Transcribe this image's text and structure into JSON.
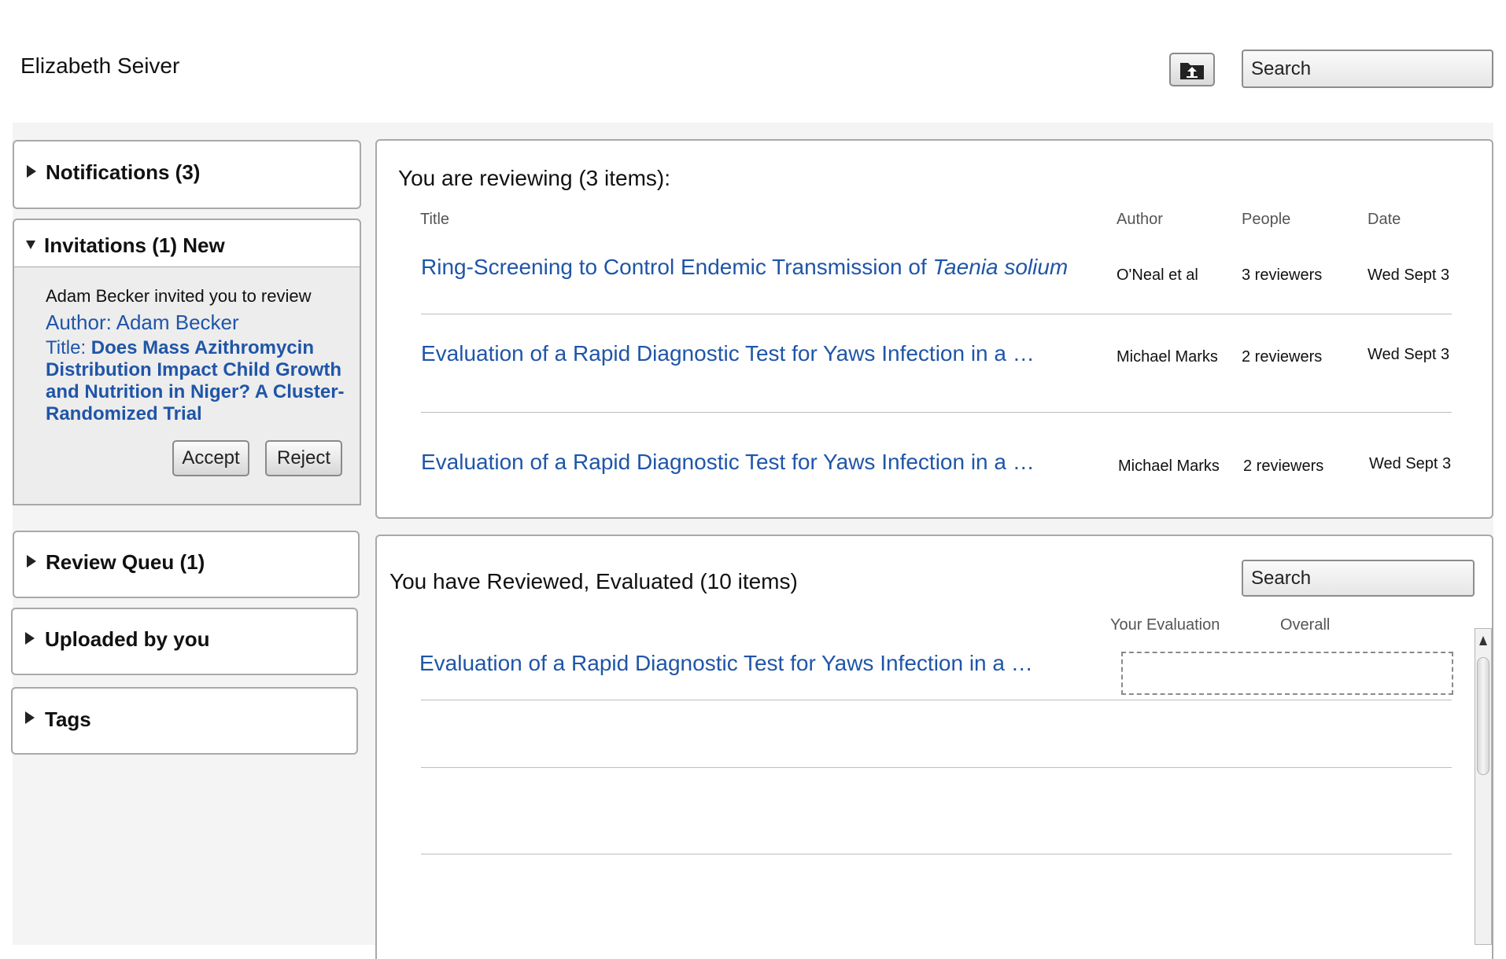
{
  "header": {
    "user_name": "Elizabeth Seiver",
    "search_placeholder": "Search",
    "upload_icon": "folder-upload-icon"
  },
  "sidebar": {
    "notifications": {
      "label": "Notifications (3)",
      "expanded": false
    },
    "invitations": {
      "label": "Invitations (1) New",
      "expanded": true,
      "message": "Adam Becker invited you to review",
      "author_label": "Author: Adam Becker",
      "title_prefix": "Title: ",
      "title_lines": [
        "Does Mass Azithromycin",
        "Distribution Impact Child Growth",
        "and Nutrition in Niger? A Cluster-",
        "Randomized Trial"
      ],
      "accept_label": "Accept",
      "reject_label": "Reject"
    },
    "review_queue": {
      "label": "Review Queu (1)",
      "expanded": false
    },
    "uploaded": {
      "label": "Uploaded by you",
      "expanded": false
    },
    "tags": {
      "label": "Tags",
      "expanded": false
    }
  },
  "reviewing": {
    "heading": "You are reviewing (3 items):",
    "columns": {
      "title": "Title",
      "author": "Author",
      "people": "People",
      "date": "Date"
    },
    "rows": [
      {
        "title": "Ring-Screening to Control Endemic Transmission of ",
        "title_italic": "Taenia solium",
        "author": "O'Neal et al",
        "people": "3 reviewers",
        "date": "Wed Sept 3"
      },
      {
        "title": "Evaluation of a Rapid Diagnostic Test for Yaws Infection in a …",
        "title_italic": "",
        "author": "Michael Marks",
        "people": "2 reviewers",
        "date": "Wed Sept 3"
      },
      {
        "title": "Evaluation of a Rapid Diagnostic Test for Yaws Infection in a …",
        "title_italic": "",
        "author": "Michael Marks",
        "people": "2 reviewers",
        "date": "Wed Sept 3"
      }
    ]
  },
  "reviewed": {
    "heading": "You have Reviewed, Evaluated (10 items)",
    "search_placeholder": "Search",
    "columns": {
      "your_evaluation": "Your Evaluation",
      "overall": "Overall"
    },
    "rows": [
      {
        "title": "Evaluation of a Rapid Diagnostic Test for Yaws Infection in a …"
      }
    ]
  },
  "colors": {
    "link": "#1f55a8",
    "panel_border": "#a9a9a9",
    "background_band": "#f4f4f4"
  }
}
